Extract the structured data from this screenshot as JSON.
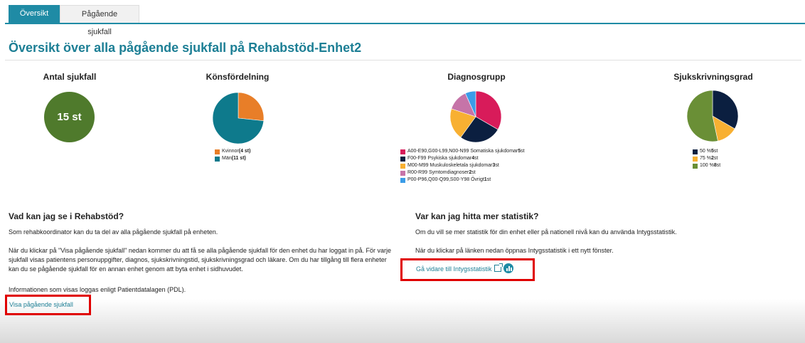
{
  "tabs": [
    {
      "label": "Översikt",
      "active": true
    },
    {
      "label": "Pågående sjukfall",
      "active": false
    }
  ],
  "page_title": "Översikt över alla pågående sjukfall på Rehabstöd-Enhet2",
  "charts": {
    "count": {
      "title": "Antal sjukfall",
      "value": "15 st"
    },
    "gender": {
      "title": "Könsfördelning",
      "legend": [
        {
          "label": "Kvinnor",
          "bold": "(4 st)",
          "color": "#e87e28"
        },
        {
          "label": "Män",
          "bold": "(11 st)",
          "color": "#0e7a8c"
        }
      ]
    },
    "diagnosis": {
      "title": "Diagnosgrupp",
      "legend": [
        {
          "label": "A00-E90,G00-L99,N00-N99 Somatiska sjukdomar",
          "bold": "5",
          "suffix": "st",
          "color": "#d81b5a"
        },
        {
          "label": "F00-F99 Psykiska sjukdomar",
          "bold": "4",
          "suffix": "st",
          "color": "#0b1f40"
        },
        {
          "label": "M00-M99 Muskuloskeletala sjukdomar",
          "bold": "3",
          "suffix": "st",
          "color": "#f8b032"
        },
        {
          "label": "R00-R99 Symtomdiagnoser",
          "bold": "2",
          "suffix": "st",
          "color": "#c674a8"
        },
        {
          "label": "P00-P96,Q00-Q99,S00-Y98 Övrigt",
          "bold": "1",
          "suffix": "st",
          "color": "#3b9ce8"
        }
      ]
    },
    "degree": {
      "title": "Sjukskrivningsgrad",
      "legend": [
        {
          "label": "50 %",
          "bold": "5",
          "suffix": "st",
          "color": "#0b1f40"
        },
        {
          "label": "75 %",
          "bold": "2",
          "suffix": "st",
          "color": "#f8b032"
        },
        {
          "label": "100 %",
          "bold": "8",
          "suffix": "st",
          "color": "#6a8f36"
        }
      ]
    }
  },
  "chart_data": [
    {
      "type": "pie",
      "title": "Könsfördelning",
      "categories": [
        "Kvinnor",
        "Män"
      ],
      "values": [
        4,
        11
      ]
    },
    {
      "type": "pie",
      "title": "Diagnosgrupp",
      "categories": [
        "A00-E90,G00-L99,N00-N99 Somatiska sjukdomar",
        "F00-F99 Psykiska sjukdomar",
        "M00-M99 Muskuloskeletala sjukdomar",
        "R00-R99 Symtomdiagnoser",
        "P00-P96,Q00-Q99,S00-Y98 Övrigt"
      ],
      "values": [
        5,
        4,
        3,
        2,
        1
      ]
    },
    {
      "type": "pie",
      "title": "Sjukskrivningsgrad",
      "categories": [
        "50 %",
        "75 %",
        "100 %"
      ],
      "values": [
        5,
        2,
        8
      ]
    }
  ],
  "left_info": {
    "heading": "Vad kan jag se i Rehabstöd?",
    "p1": "Som rehabkoordinator kan du ta del av alla pågående sjukfall på enheten.",
    "p2": "När du klickar på \"Visa pågående sjukfall\" nedan kommer du att få se alla pågående sjukfall för den enhet du har loggat in på. För varje sjukfall visas patientens personuppgifter, diagnos, sjukskrivningstid, sjukskrivningsgrad och läkare. Om du har tillgång till flera enheter kan du se pågående sjukfall för en annan enhet genom att byta enhet i sidhuvudet.",
    "p3": "Informationen som visas loggas enligt Patientdatalagen (PDL).",
    "link": "Visa pågående sjukfall"
  },
  "right_info": {
    "heading": "Var kan jag hitta mer statistik?",
    "p1": "Om du vill se mer statistik för din enhet eller på nationell nivå kan du använda Intygsstatistik.",
    "p2": "När du klickar på länken nedan öppnas Intygsstatistik i ett nytt fönster.",
    "link": "Gå vidare till Intygsstatistik"
  }
}
